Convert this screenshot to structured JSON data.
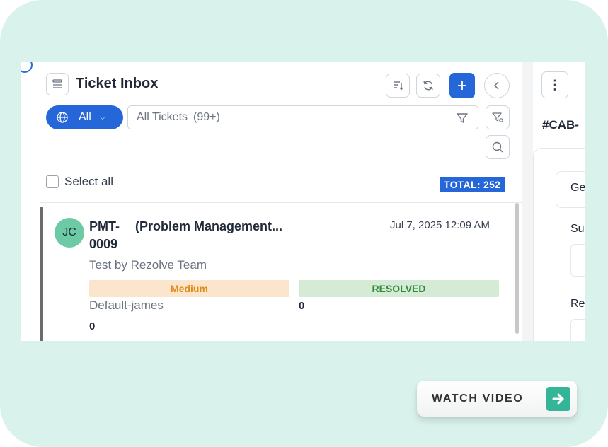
{
  "header": {
    "title": "Ticket Inbox",
    "all_label": "All",
    "search_text": "All Tickets",
    "search_count": "(99+)"
  },
  "list": {
    "select_all": "Select all",
    "total": "TOTAL: 252"
  },
  "tickets": [
    {
      "avatar": "JC",
      "id": "PMT-0009",
      "name": "(Problem Management...",
      "date": "Jul 7, 2025 12:09 AM",
      "description": "Test by Rezolve Team",
      "priority": "Medium",
      "status": "RESOLVED",
      "group": "Default-james",
      "count_a": "0",
      "count_b": "0"
    }
  ],
  "right_panel": {
    "ticket_ref": "#CAB-",
    "tab_label": "Ge",
    "field1_label": "Su",
    "field2_label": "Re"
  },
  "cta": {
    "label": "WATCH VIDEO"
  },
  "colors": {
    "background": "#d9f2ec",
    "accent": "#2566d8",
    "avatar": "#6ccba4",
    "medium": "#e08a16",
    "resolved": "#2f8a3a",
    "cta_icon": "#35b597"
  },
  "icons": [
    "list-icon",
    "sort-icon",
    "refresh-icon",
    "plus-icon",
    "chevron-left-icon",
    "globe-icon",
    "chevron-down-icon",
    "filter-icon",
    "filter-settings-icon",
    "search-icon",
    "more-icon",
    "arrow-right-icon"
  ]
}
